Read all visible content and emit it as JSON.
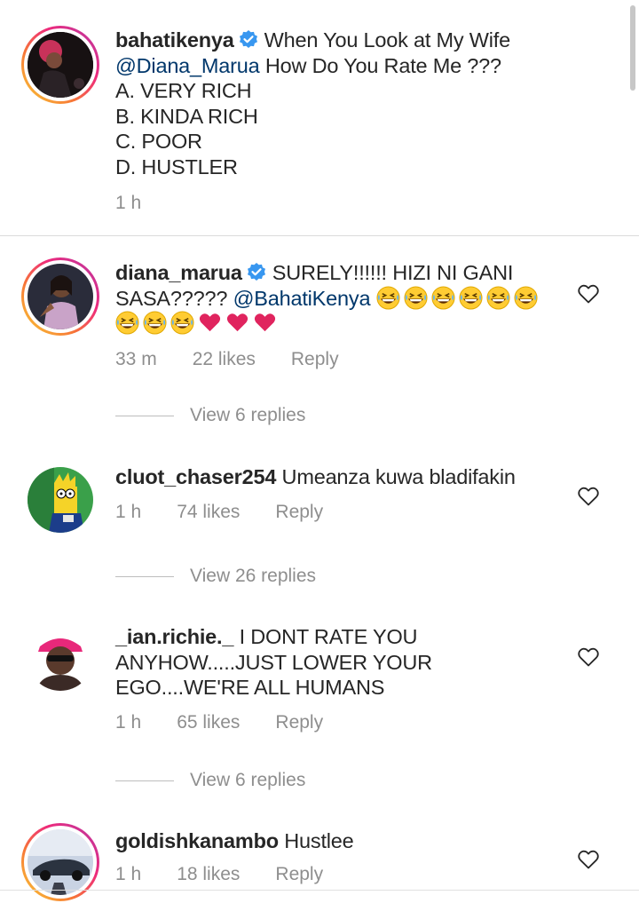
{
  "caption": {
    "username": "bahatikenya",
    "lines": [
      "When You Look at My Wife",
      "How Do You Rate Me ???",
      "A. VERY RICH",
      "B. KINDA RICH",
      "C. POOR",
      "D. HUSTLER"
    ],
    "mention": "@Diana_Marua",
    "time": "1 h"
  },
  "comments": [
    {
      "username": "diana_marua",
      "text_a": "SURELY!!!!!! HIZI NI GANI",
      "text_b": "SASA?????",
      "mention": "@BahatiKenya",
      "time": "33 m",
      "likes": "22 likes",
      "reply": "Reply",
      "view_replies": "View 6 replies"
    },
    {
      "username": "cluot_chaser254",
      "text": "Umeanza kuwa  bladifakin",
      "time": "1 h",
      "likes": "74 likes",
      "reply": "Reply",
      "view_replies": "View 26 replies"
    },
    {
      "username": "_ian.richie._",
      "text_a": "I DONT RATE YOU",
      "text_b": "ANYHOW.....JUST LOWER YOUR",
      "text_c": "EGO....WE'RE ALL HUMANS",
      "time": "1 h",
      "likes": "65 likes",
      "reply": "Reply",
      "view_replies": "View 6 replies"
    },
    {
      "username": "goldishkanambo",
      "text": "Hustlee",
      "time": "1 h",
      "likes": "18 likes",
      "reply": "Reply"
    }
  ],
  "colors": {
    "verified": "#3897f0",
    "mention": "#00376b",
    "meta": "#8e8e8e",
    "heart": "#e0245e"
  },
  "icons": {
    "verified": "verified-badge-icon",
    "like": "heart-outline-icon",
    "emoji_laugh": "grinning-squinting-emoji",
    "emoji_heart": "purple-heart-emoji"
  }
}
